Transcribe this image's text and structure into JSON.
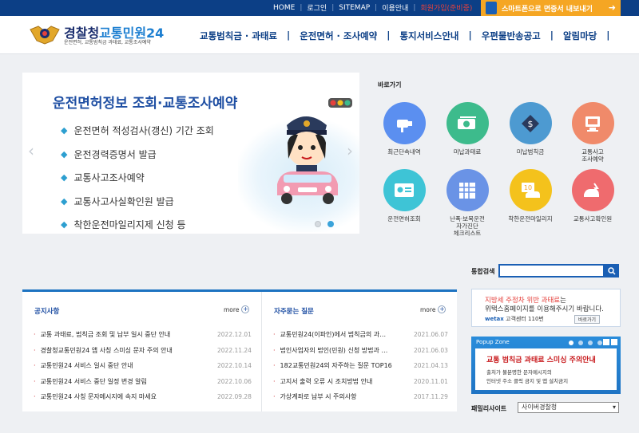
{
  "topbar": {
    "links": [
      "HOME",
      "로그인",
      "SITEMAP",
      "이용안내"
    ],
    "red_link": "회원가입(준비중)",
    "app_button": "스마트폰으로 면증서 내보내기"
  },
  "header": {
    "brand_prefix": "경찰청",
    "brand_main": "교통민원24",
    "brand_sub": "운전면허, 교통범칙금 과태료, 교통조사예약",
    "nav": [
      "교통범칙금 · 과태료",
      "운전면허 · 조사예약",
      "통지서비스안내",
      "우편물반송공고",
      "알림마당"
    ]
  },
  "banner": {
    "title": "운전면허정보 조회·교통조사예약",
    "items": [
      "운전면허 적성검사(갱신) 기간 조회",
      "운전경력증명서 발급",
      "교통사고조사예약",
      "교통사고사실확인원 발급",
      "착한운전마일리지제 신청 등"
    ],
    "prev": "‹",
    "next": "›"
  },
  "quick": {
    "title": "바로가기",
    "items": [
      {
        "label": "최근단속내역",
        "icon": "camera-icon",
        "color": "#5b8ff0"
      },
      {
        "label": "미납과태료",
        "icon": "money-icon",
        "color": "#3dbb8c"
      },
      {
        "label": "미납범칙금",
        "icon": "tax-icon",
        "color": "#4d9ad1"
      },
      {
        "label": "교통사고",
        "label2": "조사예약",
        "icon": "computer-icon",
        "color": "#f08a6a"
      },
      {
        "label": "운전면허조회",
        "icon": "license-icon",
        "color": "#3ec4d6"
      },
      {
        "label": "난폭·보복운전",
        "label2": "자가진단",
        "label3": "체크리스트",
        "icon": "checklist-icon",
        "color": "#6a93e6"
      },
      {
        "label": "착한운전마일리지",
        "icon": "mileage-icon",
        "color": "#f4c21c"
      },
      {
        "label": "교통사고확인원",
        "icon": "accident-icon",
        "color": "#ef6b6e"
      }
    ]
  },
  "search": {
    "label": "통합검색",
    "button": "🔍"
  },
  "notices": {
    "title": "공지사항",
    "more": "more",
    "items": [
      {
        "text": "교통 과태료, 범칙금 조회 및 납부 일시 중단 안내",
        "date": "2022.12.01"
      },
      {
        "text": "경찰청교통민원24 앱 사칭 스미싱 문자 주의 안내",
        "date": "2022.11.24"
      },
      {
        "text": "교통민원24 서비스 일시 중단 안내",
        "date": "2022.10.14"
      },
      {
        "text": "교통민원24 서비스 중단 일정 변경 알림",
        "date": "2022.10.06"
      },
      {
        "text": "교통민원24 사칭 문자메시지에 속지 마세요",
        "date": "2022.09.28"
      }
    ]
  },
  "faq": {
    "title": "자주묻는 질문",
    "more": "more",
    "items": [
      {
        "text": "교통민원24(이파인)에서 범칙금의 과…",
        "date": "2021.06.07"
      },
      {
        "text": "법인사업자의 법인(민원) 신청 방법과 …",
        "date": "2021.06.03"
      },
      {
        "text": "182교통민원24의 자주하는 질문 TOP16",
        "date": "2021.04.13"
      },
      {
        "text": "고지서 출력 오류 시 조치방법 안내",
        "date": "2020.11.01"
      },
      {
        "text": "가상계좌로 납부 시 주의사항",
        "date": "2017.11.29"
      }
    ]
  },
  "ad": {
    "line1_red": "지방세 주정차 위반 과태료",
    "line1_rest": "는",
    "line2": "위택스홈페이지를 이용해주시기 바랍니다.",
    "line3_brand": "wetax",
    "line3_rest": "고객센터 110번",
    "button": "바로가기"
  },
  "popup": {
    "header": "Popup Zone",
    "title": "교통 범칙금 과태료 스미싱 주의안내",
    "sub1": "출처가 불분명한 문자메시지의",
    "sub2": "인터넷 주소 클릭 금지 및 앱 설치금지"
  },
  "family": {
    "label": "패밀리사이트",
    "selected": "사이버경찰청"
  }
}
